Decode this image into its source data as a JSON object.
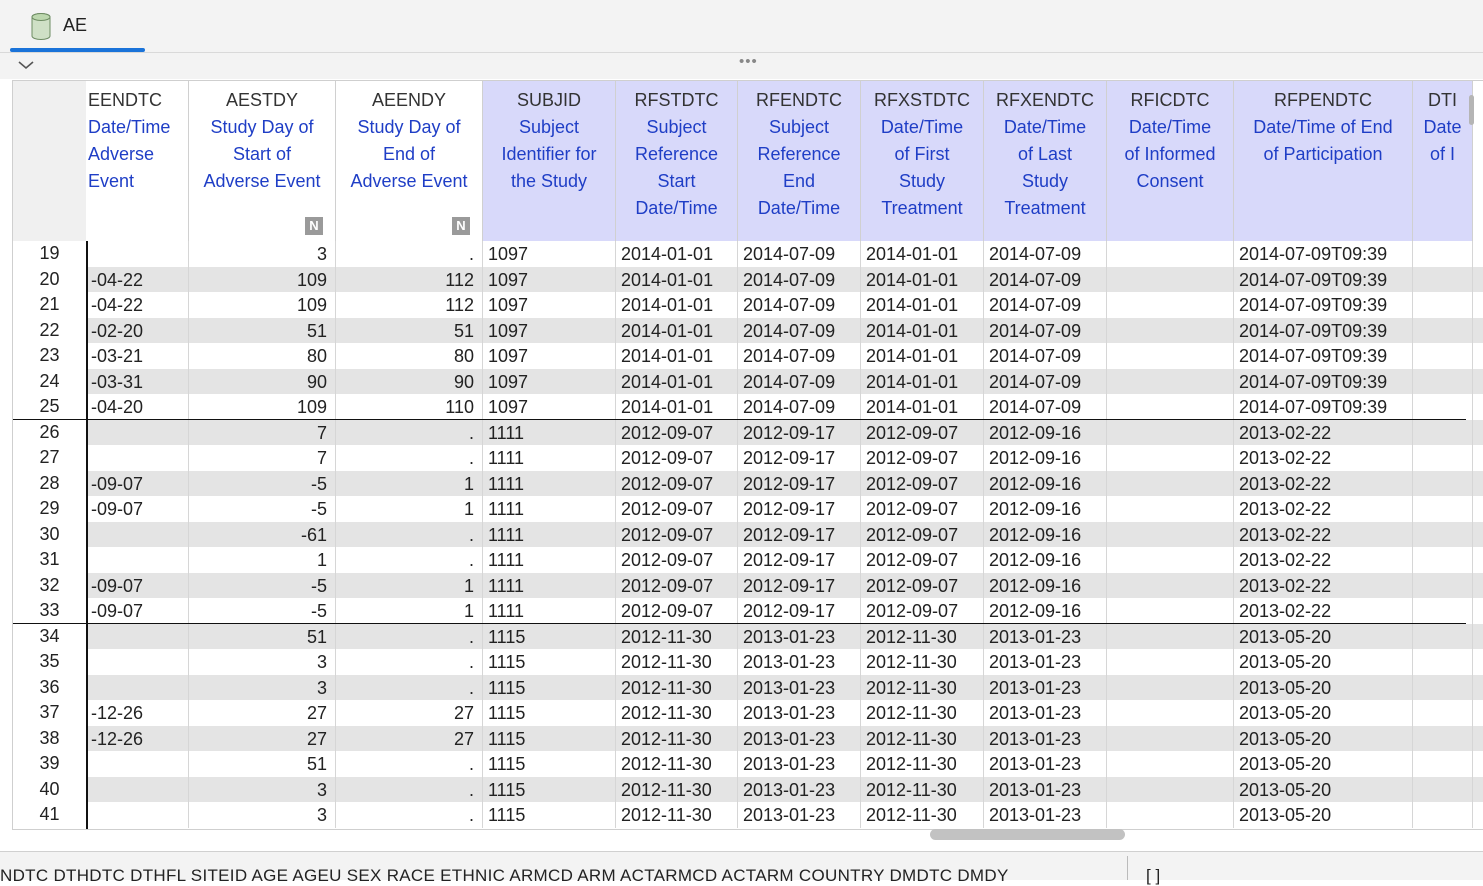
{
  "tab": {
    "label": "AE",
    "icon": "database-icon"
  },
  "toolbar": {
    "collapse_icon": "chevron-down-icon",
    "handle": "•••"
  },
  "columns": [
    {
      "name": "EENDTC",
      "label": "Date/Time\nAdverse\nEvent",
      "kind": "normal",
      "badge": ""
    },
    {
      "name": "AESTDY",
      "label": "Study Day of\nStart of\nAdverse Event",
      "kind": "normal",
      "badge": "N"
    },
    {
      "name": "AEENDY",
      "label": "Study Day of\nEnd of\nAdverse Event",
      "kind": "normal",
      "badge": "N"
    },
    {
      "name": "SUBJID",
      "label": "Subject\nIdentifier for\nthe Study",
      "kind": "joined",
      "badge": ""
    },
    {
      "name": "RFSTDTC",
      "label": "Subject\nReference\nStart\nDate/Time",
      "kind": "joined",
      "badge": ""
    },
    {
      "name": "RFENDTC",
      "label": "Subject\nReference\nEnd\nDate/Time",
      "kind": "joined",
      "badge": ""
    },
    {
      "name": "RFXSTDTC",
      "label": "Date/Time\nof First\nStudy\nTreatment",
      "kind": "joined",
      "badge": ""
    },
    {
      "name": "RFXENDTC",
      "label": "Date/Time\nof Last\nStudy\nTreatment",
      "kind": "joined",
      "badge": ""
    },
    {
      "name": "RFICDTC",
      "label": "Date/Time\nof Informed\nConsent",
      "kind": "joined",
      "badge": ""
    },
    {
      "name": "RFPENDTC",
      "label": "Date/Time of End\nof Participation",
      "kind": "joined",
      "badge": ""
    },
    {
      "name": "DTI",
      "label": "Date\nof I",
      "kind": "joined",
      "badge": ""
    }
  ],
  "rows": [
    {
      "n": "19",
      "c": [
        "",
        "3",
        ".",
        "1097",
        "2014-01-01",
        "2014-07-09",
        "2014-01-01",
        "2014-07-09",
        "",
        "2014-07-09T09:39",
        ""
      ]
    },
    {
      "n": "20",
      "c": [
        "-04-22",
        "109",
        "112",
        "1097",
        "2014-01-01",
        "2014-07-09",
        "2014-01-01",
        "2014-07-09",
        "",
        "2014-07-09T09:39",
        ""
      ]
    },
    {
      "n": "21",
      "c": [
        "-04-22",
        "109",
        "112",
        "1097",
        "2014-01-01",
        "2014-07-09",
        "2014-01-01",
        "2014-07-09",
        "",
        "2014-07-09T09:39",
        ""
      ]
    },
    {
      "n": "22",
      "c": [
        "-02-20",
        "51",
        "51",
        "1097",
        "2014-01-01",
        "2014-07-09",
        "2014-01-01",
        "2014-07-09",
        "",
        "2014-07-09T09:39",
        ""
      ]
    },
    {
      "n": "23",
      "c": [
        "-03-21",
        "80",
        "80",
        "1097",
        "2014-01-01",
        "2014-07-09",
        "2014-01-01",
        "2014-07-09",
        "",
        "2014-07-09T09:39",
        ""
      ]
    },
    {
      "n": "24",
      "c": [
        "-03-31",
        "90",
        "90",
        "1097",
        "2014-01-01",
        "2014-07-09",
        "2014-01-01",
        "2014-07-09",
        "",
        "2014-07-09T09:39",
        ""
      ]
    },
    {
      "n": "25",
      "c": [
        "-04-20",
        "109",
        "110",
        "1097",
        "2014-01-01",
        "2014-07-09",
        "2014-01-01",
        "2014-07-09",
        "",
        "2014-07-09T09:39",
        ""
      ]
    },
    {
      "n": "26",
      "c": [
        "",
        "7",
        ".",
        "1111",
        "2012-09-07",
        "2012-09-17",
        "2012-09-07",
        "2012-09-16",
        "",
        "2013-02-22",
        ""
      ]
    },
    {
      "n": "27",
      "c": [
        "",
        "7",
        ".",
        "1111",
        "2012-09-07",
        "2012-09-17",
        "2012-09-07",
        "2012-09-16",
        "",
        "2013-02-22",
        ""
      ]
    },
    {
      "n": "28",
      "c": [
        "-09-07",
        "-5",
        "1",
        "1111",
        "2012-09-07",
        "2012-09-17",
        "2012-09-07",
        "2012-09-16",
        "",
        "2013-02-22",
        ""
      ]
    },
    {
      "n": "29",
      "c": [
        "-09-07",
        "-5",
        "1",
        "1111",
        "2012-09-07",
        "2012-09-17",
        "2012-09-07",
        "2012-09-16",
        "",
        "2013-02-22",
        ""
      ]
    },
    {
      "n": "30",
      "c": [
        "",
        "-61",
        ".",
        "1111",
        "2012-09-07",
        "2012-09-17",
        "2012-09-07",
        "2012-09-16",
        "",
        "2013-02-22",
        ""
      ]
    },
    {
      "n": "31",
      "c": [
        "",
        "1",
        ".",
        "1111",
        "2012-09-07",
        "2012-09-17",
        "2012-09-07",
        "2012-09-16",
        "",
        "2013-02-22",
        ""
      ]
    },
    {
      "n": "32",
      "c": [
        "-09-07",
        "-5",
        "1",
        "1111",
        "2012-09-07",
        "2012-09-17",
        "2012-09-07",
        "2012-09-16",
        "",
        "2013-02-22",
        ""
      ]
    },
    {
      "n": "33",
      "c": [
        "-09-07",
        "-5",
        "1",
        "1111",
        "2012-09-07",
        "2012-09-17",
        "2012-09-07",
        "2012-09-16",
        "",
        "2013-02-22",
        ""
      ]
    },
    {
      "n": "34",
      "c": [
        "",
        "51",
        ".",
        "1115",
        "2012-11-30",
        "2013-01-23",
        "2012-11-30",
        "2013-01-23",
        "",
        "2013-05-20",
        ""
      ]
    },
    {
      "n": "35",
      "c": [
        "",
        "3",
        ".",
        "1115",
        "2012-11-30",
        "2013-01-23",
        "2012-11-30",
        "2013-01-23",
        "",
        "2013-05-20",
        ""
      ]
    },
    {
      "n": "36",
      "c": [
        "",
        "3",
        ".",
        "1115",
        "2012-11-30",
        "2013-01-23",
        "2012-11-30",
        "2013-01-23",
        "",
        "2013-05-20",
        ""
      ]
    },
    {
      "n": "37",
      "c": [
        "-12-26",
        "27",
        "27",
        "1115",
        "2012-11-30",
        "2013-01-23",
        "2012-11-30",
        "2013-01-23",
        "",
        "2013-05-20",
        ""
      ]
    },
    {
      "n": "38",
      "c": [
        "-12-26",
        "27",
        "27",
        "1115",
        "2012-11-30",
        "2013-01-23",
        "2012-11-30",
        "2013-01-23",
        "",
        "2013-05-20",
        ""
      ]
    },
    {
      "n": "39",
      "c": [
        "",
        "51",
        ".",
        "1115",
        "2012-11-30",
        "2013-01-23",
        "2012-11-30",
        "2013-01-23",
        "",
        "2013-05-20",
        ""
      ]
    },
    {
      "n": "40",
      "c": [
        "",
        "3",
        ".",
        "1115",
        "2012-11-30",
        "2013-01-23",
        "2012-11-30",
        "2013-01-23",
        "",
        "2013-05-20",
        ""
      ]
    },
    {
      "n": "41",
      "c": [
        "",
        "3",
        ".",
        "1115",
        "2012-11-30",
        "2013-01-23",
        "2012-11-30",
        "2013-01-23",
        "",
        "2013-05-20",
        ""
      ]
    }
  ],
  "group_breaks_after": [
    "25",
    "33"
  ],
  "bottom": {
    "variables": "NDTC  DTHDTC  DTHFL  SITEID  AGE  AGEU  SEX  RACE  ETHNIC  ARMCD  ARM  ACTARMCD  ACTARM  COUNTRY  DMDTC  DMDY",
    "brackets": "[ ]"
  },
  "colors": {
    "accent": "#1a73d9",
    "joined_header": "#d8d9fa",
    "label_text": "#1f3ec6",
    "alt_row": "#e4e4e4"
  }
}
